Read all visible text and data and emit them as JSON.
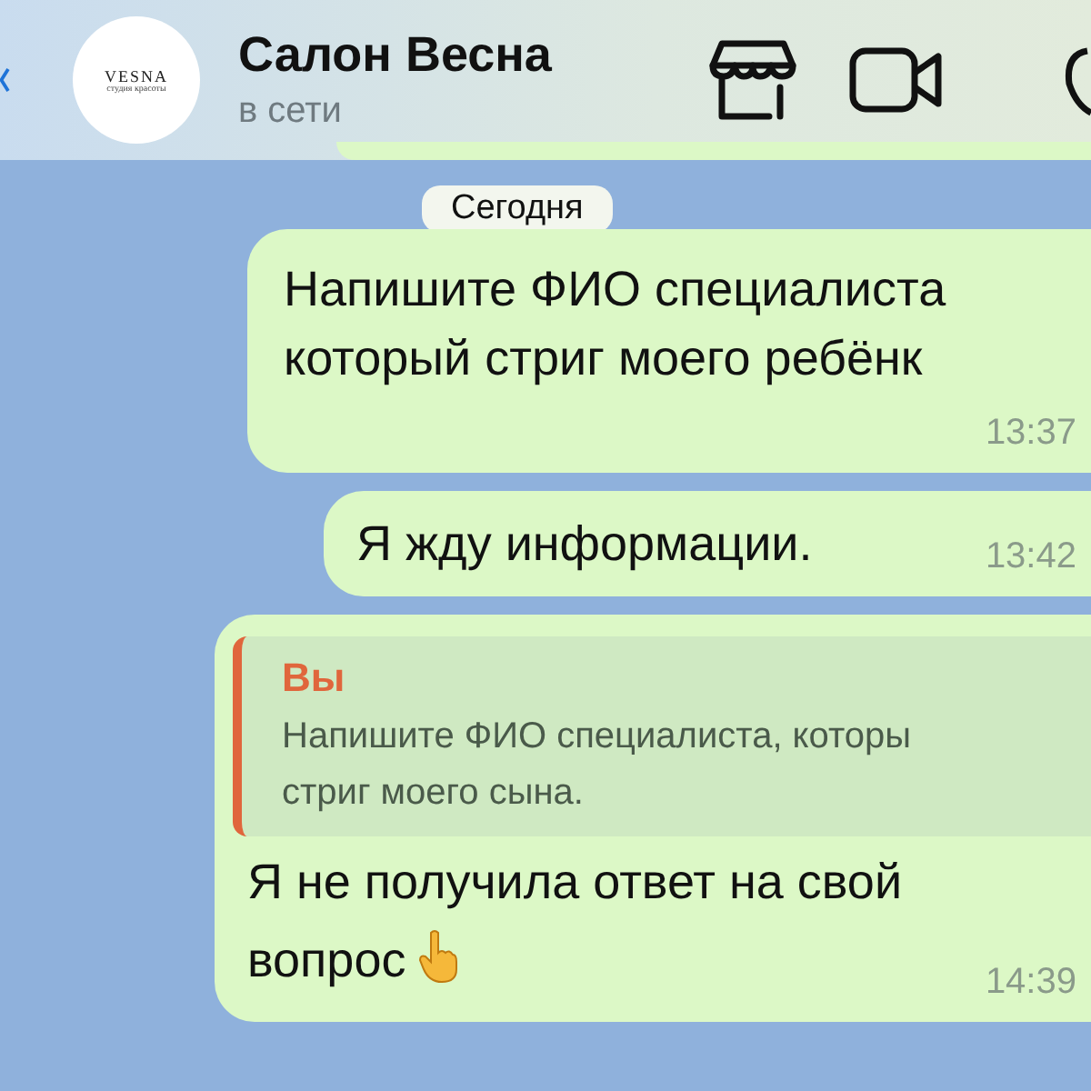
{
  "header": {
    "avatar": {
      "brand": "VESNA",
      "tagline": "студия красоты"
    },
    "title": "Салон Весна",
    "status": "в сети"
  },
  "date_chip": "Сегодня",
  "messages": [
    {
      "kind": "text",
      "text": "Напишите ФИО специалиста\nкоторый стриг моего ребёнк",
      "time": "13:37"
    },
    {
      "kind": "text",
      "text": "Я жду информации.",
      "time": "13:42"
    },
    {
      "kind": "reply",
      "quote_author": "Вы",
      "quote_text": "Напишите ФИО специалиста, которы\nстриг моего сына.",
      "text": "Я не получила ответ на свой\nвопрос",
      "emoji": true,
      "time": "14:39"
    }
  ]
}
